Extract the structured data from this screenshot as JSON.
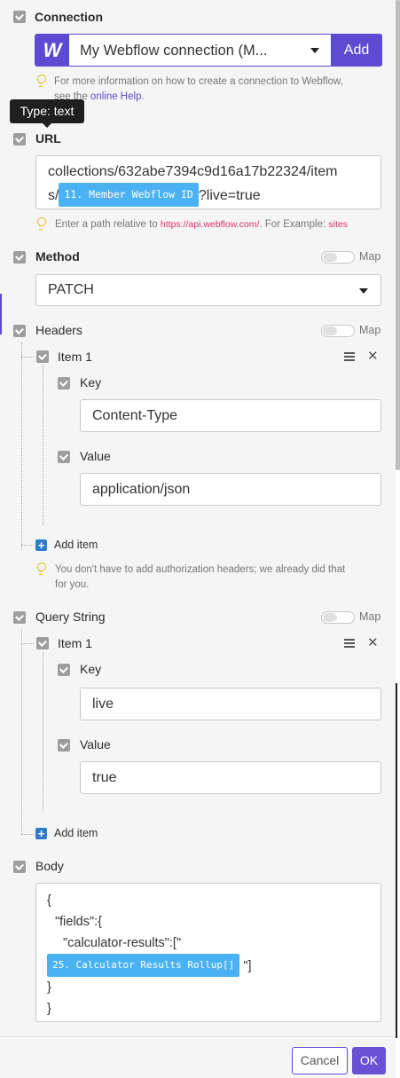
{
  "connection": {
    "label": "Connection",
    "selected": "My Webflow connection (M...",
    "add_label": "Add",
    "logo": "W",
    "hint_line1": "For more information on how to create a connection to Webflow,",
    "hint_line2_prefix": "see the ",
    "hint_link": "online Help",
    "hint_suffix": "."
  },
  "tooltip": {
    "text": "Type: text"
  },
  "url": {
    "label": "URL",
    "line1": "collections/632abe7394c9d16a17b22324/item",
    "line2_prefix": "s/",
    "pill": "11. Member Webflow ID",
    "line2_suffix": "?live=true",
    "hint_prefix": "Enter a path relative to ",
    "hint_link": "https://api.webflow.com/",
    "hint_mid": ". For Example: ",
    "hint_example": "sites"
  },
  "method": {
    "label": "Method",
    "value": "PATCH",
    "map_label": "Map"
  },
  "headers": {
    "label": "Headers",
    "map_label": "Map",
    "item_label": "Item 1",
    "key_label": "Key",
    "key_value": "Content-Type",
    "value_label": "Value",
    "value_value": "application/json",
    "add_item": "Add item",
    "hint_line1": "You don't have to add authorization headers; we already did that",
    "hint_line2": "for you."
  },
  "query": {
    "label": "Query String",
    "map_label": "Map",
    "item_label": "Item 1",
    "key_label": "Key",
    "key_value": "live",
    "value_label": "Value",
    "value_value": "true",
    "add_item": "Add item"
  },
  "body": {
    "label": "Body",
    "line1": "{",
    "line2": "\"fields\":{",
    "line3": "\"calculator-results\":[\"",
    "pill": "25. Calculator Results Rollup[]",
    "line4_suffix": "\"]",
    "line5": "}",
    "line6": "}"
  },
  "footer": {
    "cancel": "Cancel",
    "ok": "OK"
  },
  "colors": {
    "accent": "#5c4bd1",
    "pill": "#4ab2f2"
  }
}
